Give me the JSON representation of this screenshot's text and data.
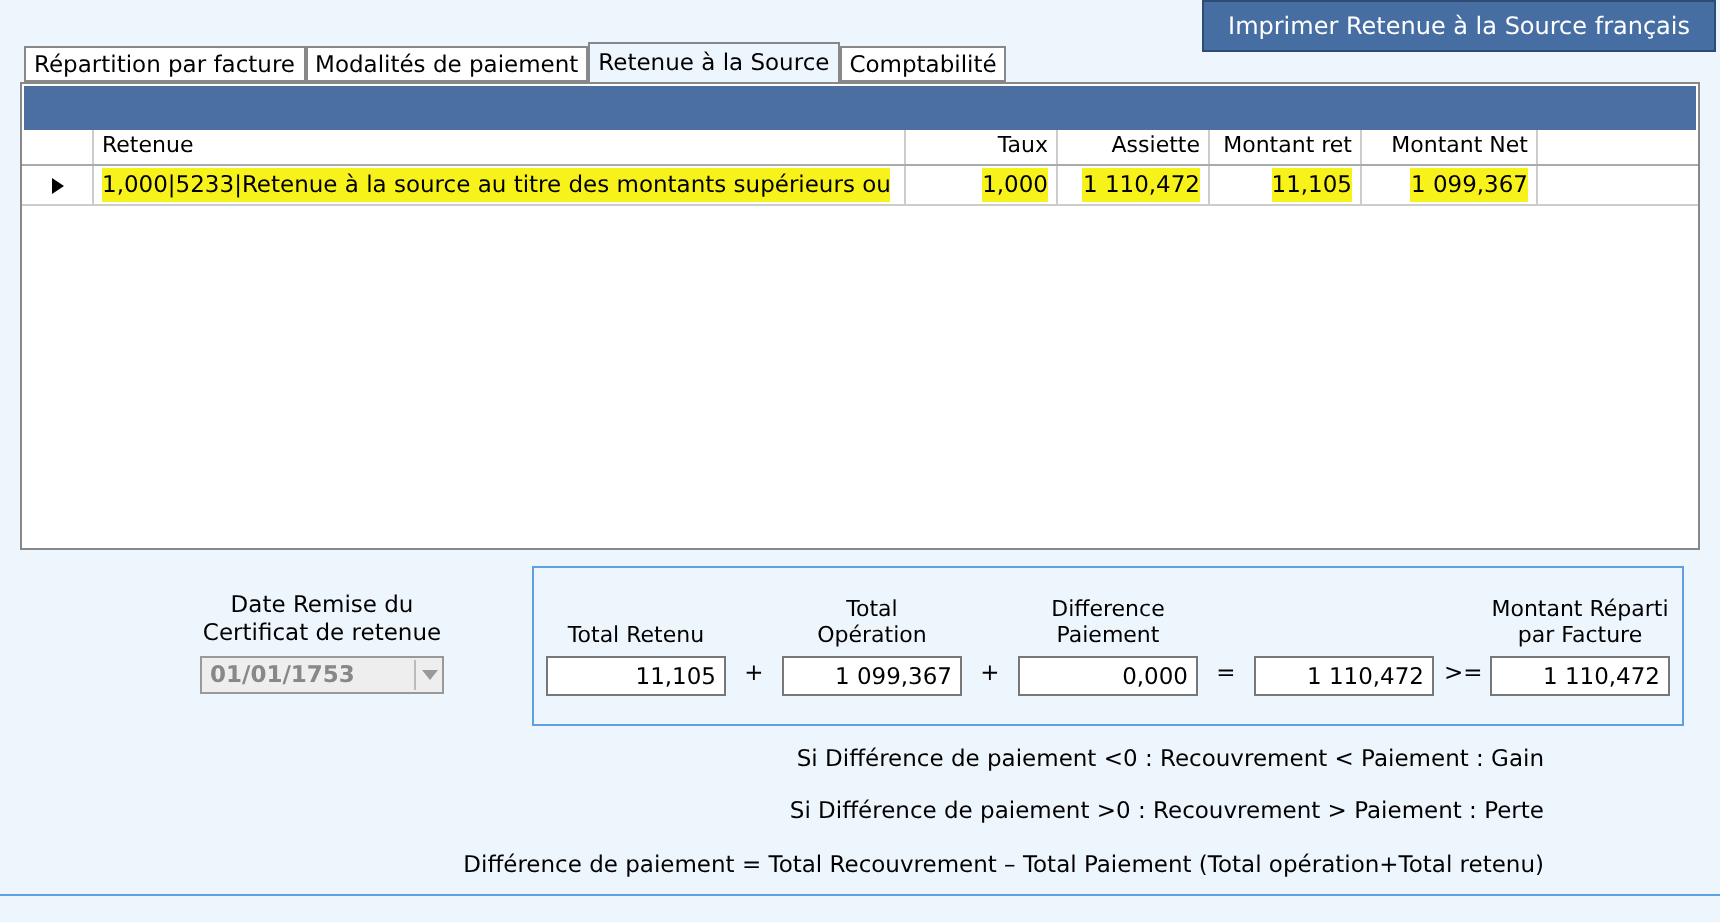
{
  "print_button": "Imprimer Retenue à la Source français",
  "tabs": [
    {
      "label": "Répartition par facture",
      "selected": false
    },
    {
      "label": "Modalités de paiement",
      "selected": false
    },
    {
      "label": "Retenue à la Source",
      "selected": true
    },
    {
      "label": "Comptabilité",
      "selected": false
    }
  ],
  "table": {
    "columns": [
      "Retenue",
      "Taux",
      "Assiette",
      "Montant ret",
      "Montant Net"
    ],
    "rows": [
      {
        "current": true,
        "highlighted": true,
        "cells": [
          "1,000|5233|Retenue à la source au titre des montants supérieurs ou",
          "1,000",
          "1 110,472",
          "11,105",
          "1 099,367"
        ]
      }
    ]
  },
  "date": {
    "label": "Date Remise du Certificat de retenue",
    "value": "01/01/1753",
    "disabled": true
  },
  "totals": [
    {
      "label": "Total Retenu",
      "value": "11,105",
      "operator": "+"
    },
    {
      "label": "Total Opération",
      "value": "1 099,367",
      "operator": "+"
    },
    {
      "label": "Difference Paiement",
      "value": "0,000",
      "operator": "="
    },
    {
      "value": "1 110,472",
      "operator": ">="
    },
    {
      "label": "Montant Réparti par Facture",
      "value": "1 110,472"
    }
  ],
  "notes": [
    "Si Différence de paiement <0 : Recouvrement < Paiement : Gain",
    "Si Différence de paiement >0 : Recouvrement > Paiement : Perte",
    "Différence de paiement = Total Recouvrement – Total Paiement (Total opération+Total retenu)"
  ]
}
